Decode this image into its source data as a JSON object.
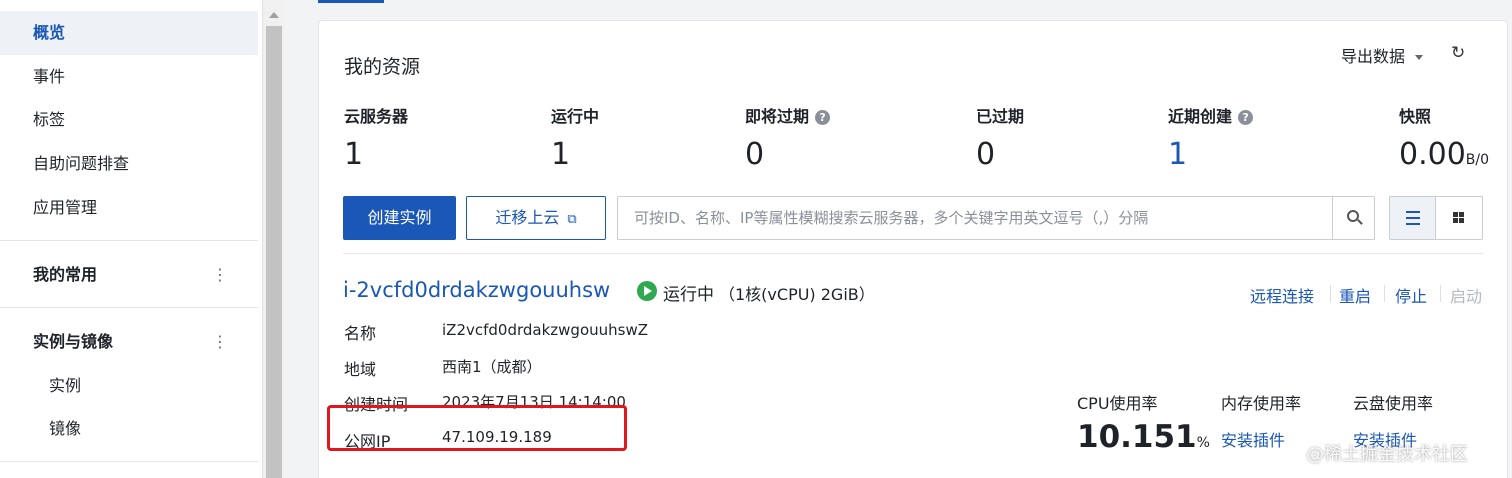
{
  "sidebar": {
    "items": [
      {
        "label": "概览"
      },
      {
        "label": "事件"
      },
      {
        "label": "标签"
      },
      {
        "label": "自助问题排查"
      },
      {
        "label": "应用管理"
      }
    ],
    "groups": [
      {
        "label": "我的常用"
      },
      {
        "label": "实例与镜像",
        "children": [
          {
            "label": "实例"
          },
          {
            "label": "镜像"
          }
        ]
      }
    ]
  },
  "overview": {
    "title": "我的资源",
    "export_label": "导出数据",
    "stats": [
      {
        "label": "云服务器",
        "value": "1"
      },
      {
        "label": "运行中",
        "value": "1"
      },
      {
        "label": "即将过期",
        "value": "0",
        "help": "?"
      },
      {
        "label": "已过期",
        "value": "0"
      },
      {
        "label": "近期创建",
        "value": "1",
        "help": "?"
      },
      {
        "label": "快照",
        "value": "0.00",
        "unit": "B/0"
      }
    ]
  },
  "toolbar": {
    "create_label": "创建实例",
    "migrate_label": "迁移上云",
    "search_placeholder": "可按ID、名称、IP等属性模糊搜索云服务器，多个关键字用英文逗号（,）分隔"
  },
  "instance": {
    "id": "i-2vcfd0drdakzwgouuhsw",
    "status": "运行中",
    "spec": "（1核(vCPU) 2GiB）",
    "actions": {
      "remote": "远程连接",
      "reboot": "重启",
      "stop": "停止",
      "start": "启动"
    },
    "fields": [
      {
        "label": "名称",
        "value": "iZ2vcfd0drdakzwgouuhswZ"
      },
      {
        "label": "地域",
        "value": "西南1（成都）"
      },
      {
        "label": "创建时间",
        "value": "2023年7月13日 14:14:00"
      },
      {
        "label": "公网IP",
        "value": "47.109.19.189"
      }
    ],
    "metrics": {
      "cpu_label": "CPU使用率",
      "cpu_value": "10.151",
      "cpu_unit": "%",
      "mem_label": "内存使用率",
      "mem_action": "安装插件",
      "disk_label": "云盘使用率",
      "disk_action": "安装插件"
    }
  },
  "watermark": "@稀土掘金技术社区"
}
